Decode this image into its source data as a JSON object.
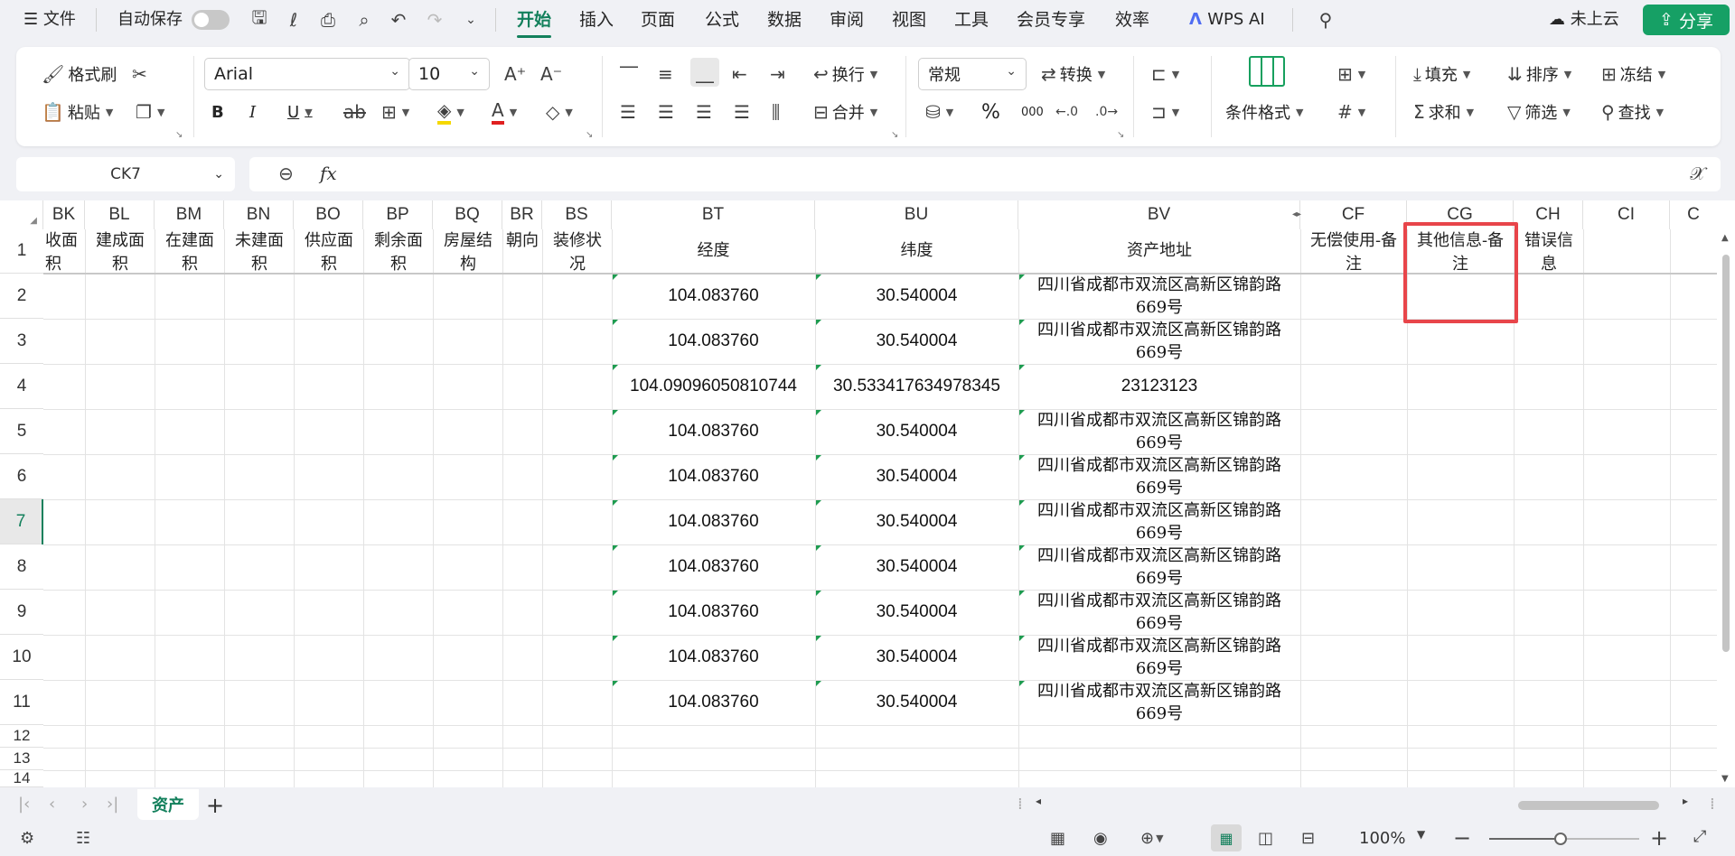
{
  "app": {
    "file_menu": "文件",
    "autosave_label": "自动保存",
    "tabs": [
      "开始",
      "插入",
      "页面",
      "公式",
      "数据",
      "审阅",
      "视图",
      "工具",
      "会员专享",
      "效率"
    ],
    "active_tab": "开始",
    "wps_ai": "WPS AI",
    "cloud_status": "未上云",
    "share": "分享"
  },
  "ribbon": {
    "format_painter": "格式刷",
    "paste": "粘贴",
    "font_name": "Arial",
    "font_size": "10",
    "bold": "B",
    "italic": "I",
    "underline": "U",
    "wrap": "换行",
    "merge": "合并",
    "number_format": "常规",
    "convert": "转换",
    "conditional_format": "条件格式",
    "fill": "填充",
    "sort": "排序",
    "freeze": "冻结",
    "sum": "求和",
    "filter": "筛选",
    "find": "查找",
    "percent": "%",
    "thousands": "000"
  },
  "formula_bar": {
    "name_box": "CK7",
    "fx": "fx",
    "formula": ""
  },
  "grid": {
    "columns": [
      "BK",
      "BL",
      "BM",
      "BN",
      "BO",
      "BP",
      "BQ",
      "BR",
      "BS",
      "BT",
      "BU",
      "BV",
      "CF",
      "CG",
      "CH",
      "CI",
      "C"
    ],
    "rows": [
      "1",
      "2",
      "3",
      "4",
      "5",
      "6",
      "7",
      "8",
      "9",
      "10",
      "11",
      "12",
      "13",
      "14"
    ],
    "headers": {
      "BK": "收面积",
      "BL": "建成面积",
      "BM": "在建面积",
      "BN": "未建面积",
      "BO": "供应面积",
      "BP": "剩余面积",
      "BQ": "房屋结构",
      "BR": "朝向",
      "BS": "装修状况",
      "BT": "经度",
      "BU": "纬度",
      "BV": "资产地址",
      "CF": "无偿使用-备注",
      "CG": "其他信息-备注",
      "CH": "错误信息"
    },
    "data_rows": [
      {
        "lng": "104.083760",
        "lat": "30.540004",
        "addr1": "四川省成都市双流区高新区锦韵路",
        "addr2": "669号"
      },
      {
        "lng": "104.083760",
        "lat": "30.540004",
        "addr1": "四川省成都市双流区高新区锦韵路",
        "addr2": "669号"
      },
      {
        "lng": "104.09096050810744",
        "lat": "30.533417634978345",
        "addr1": "23123123",
        "addr2": ""
      },
      {
        "lng": "104.083760",
        "lat": "30.540004",
        "addr1": "四川省成都市双流区高新区锦韵路",
        "addr2": "669号"
      },
      {
        "lng": "104.083760",
        "lat": "30.540004",
        "addr1": "四川省成都市双流区高新区锦韵路",
        "addr2": "669号"
      },
      {
        "lng": "104.083760",
        "lat": "30.540004",
        "addr1": "四川省成都市双流区高新区锦韵路",
        "addr2": "669号"
      },
      {
        "lng": "104.083760",
        "lat": "30.540004",
        "addr1": "四川省成都市双流区高新区锦韵路",
        "addr2": "669号"
      },
      {
        "lng": "104.083760",
        "lat": "30.540004",
        "addr1": "四川省成都市双流区高新区锦韵路",
        "addr2": "669号"
      },
      {
        "lng": "104.083760",
        "lat": "30.540004",
        "addr1": "四川省成都市双流区高新区锦韵路",
        "addr2": "669号"
      },
      {
        "lng": "104.083760",
        "lat": "30.540004",
        "addr1": "四川省成都市双流区高新区锦韵路",
        "addr2": "669号"
      }
    ]
  },
  "sheets": {
    "active": "资产"
  },
  "status": {
    "zoom": "100%"
  },
  "colors": {
    "accent": "#13805c",
    "highlight_box": "#e8454a",
    "share_bg": "#16a065"
  }
}
